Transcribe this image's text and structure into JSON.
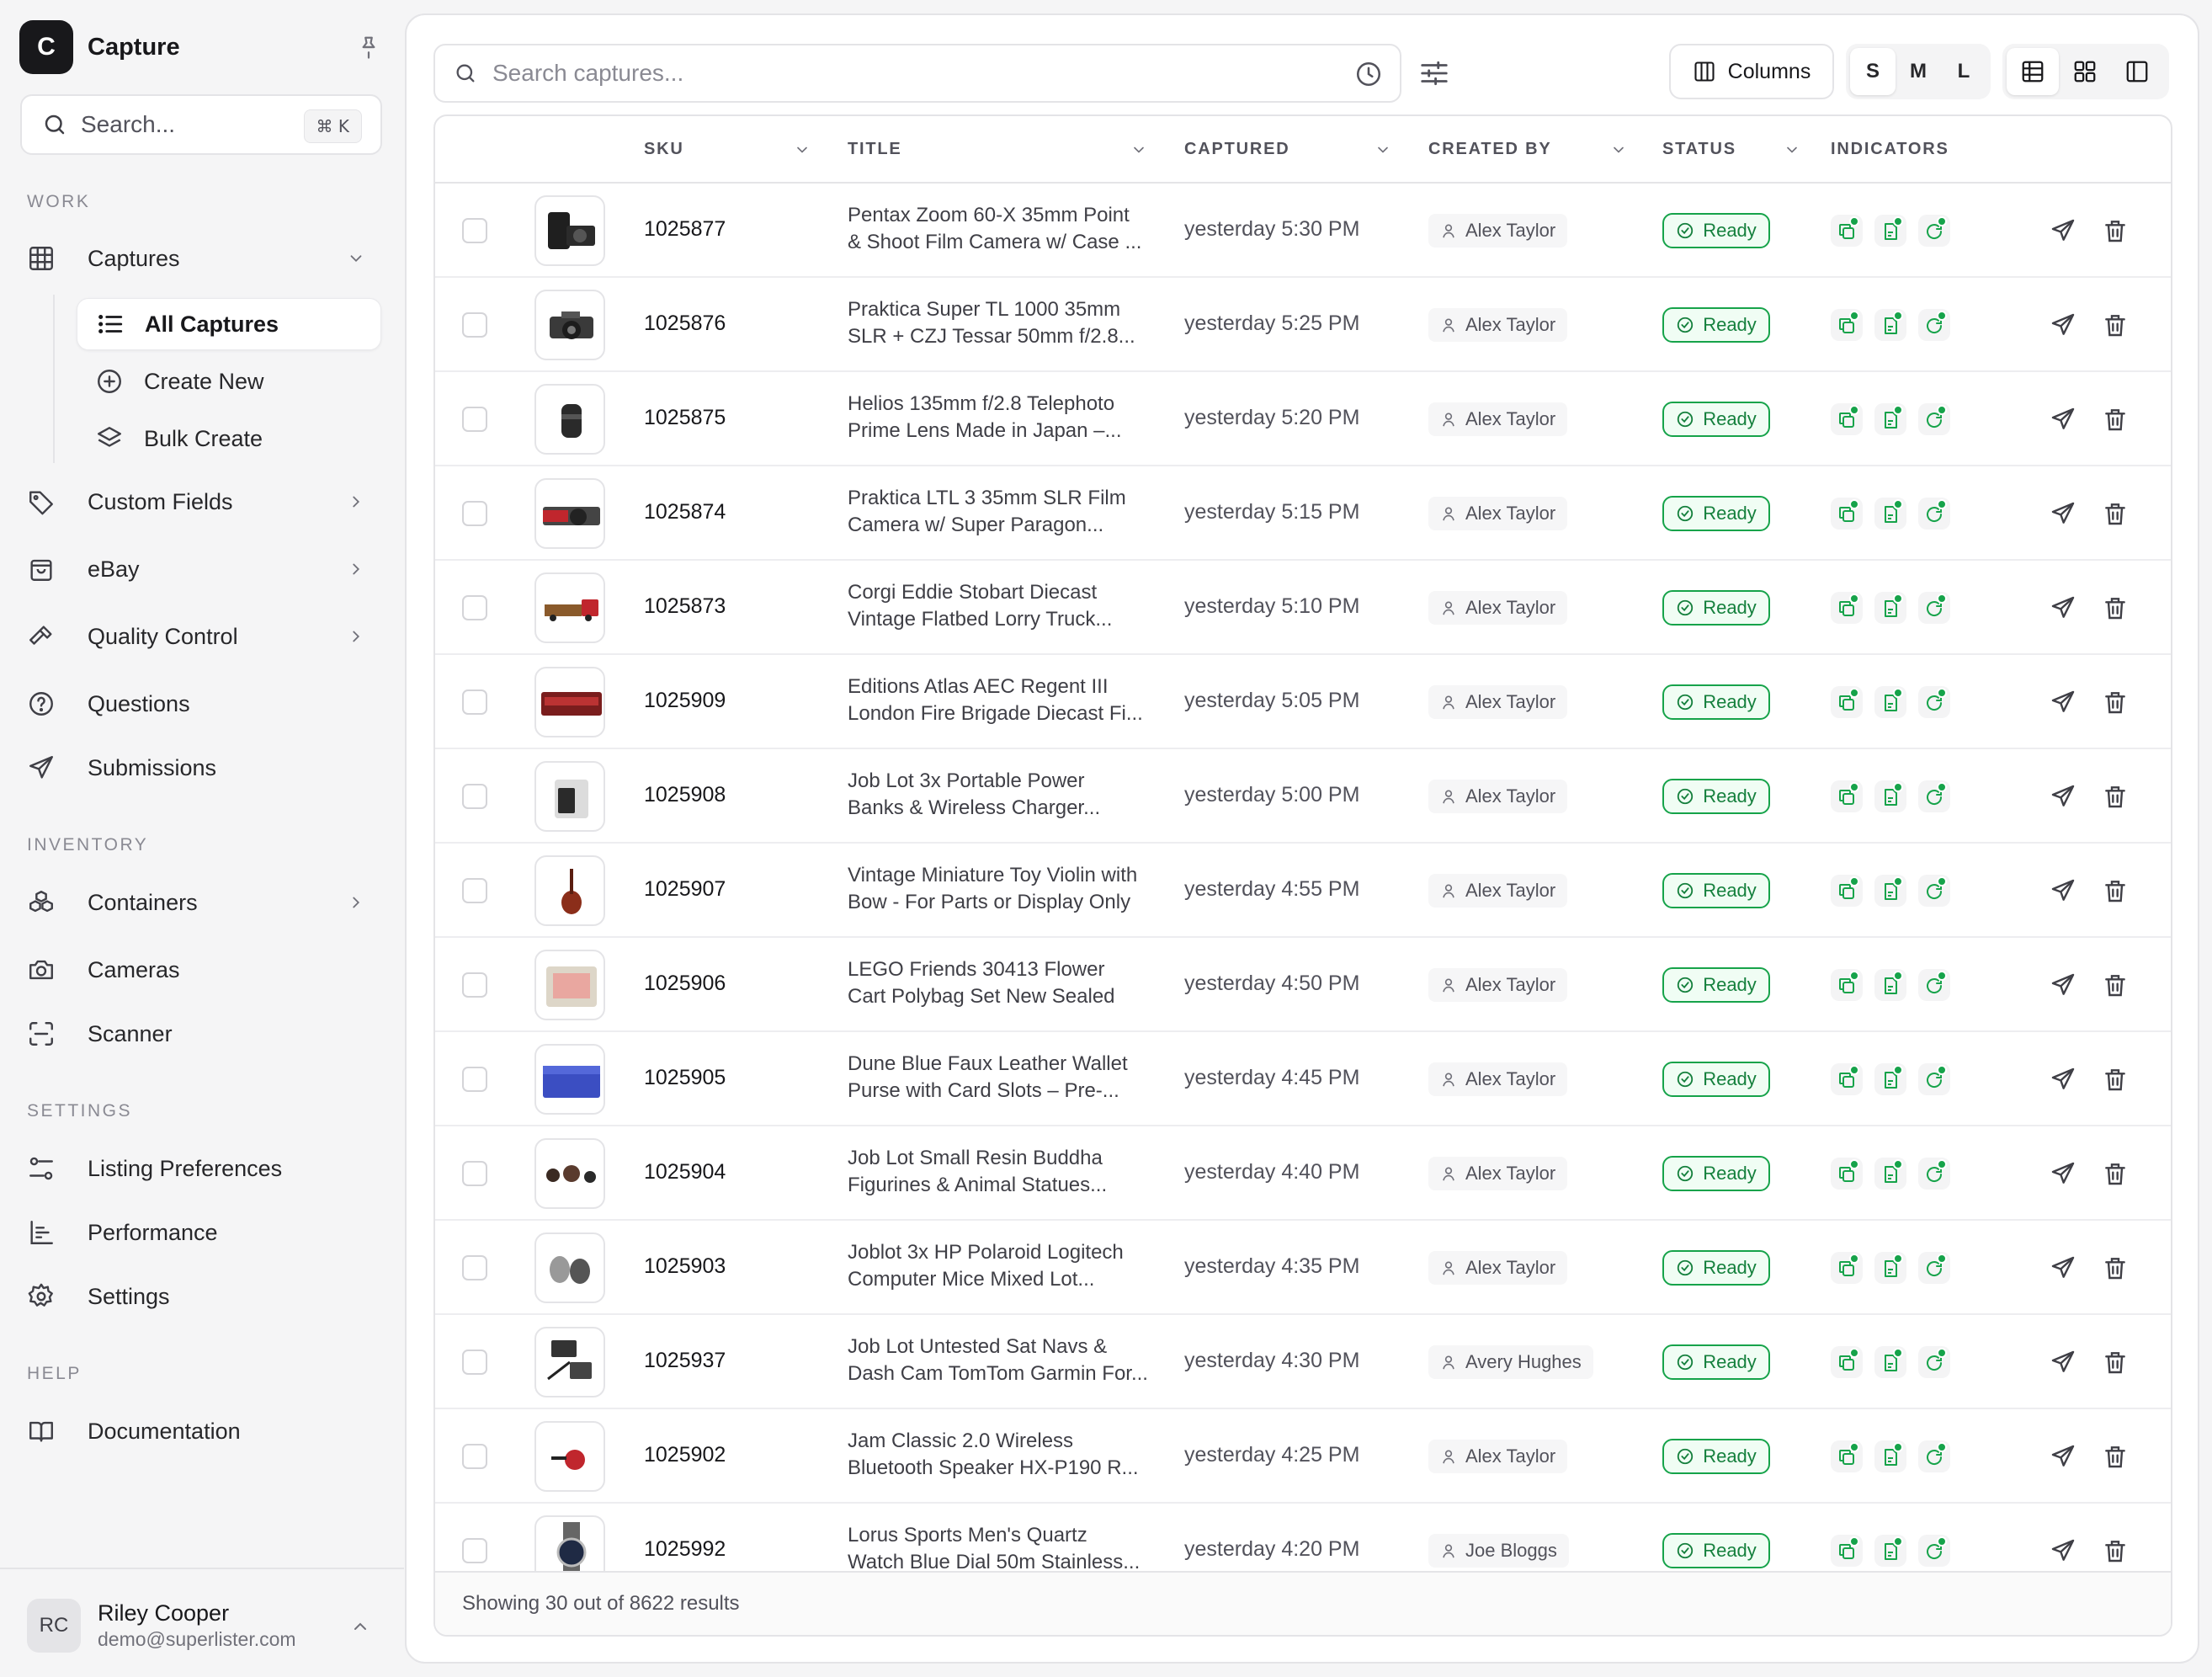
{
  "app": {
    "logo_letter": "C",
    "name": "Capture"
  },
  "sidebar": {
    "search_placeholder": "Search...",
    "search_shortcut": "⌘ K",
    "sections": {
      "work": "WORK",
      "inventory": "INVENTORY",
      "settings": "SETTINGS",
      "help": "HELP"
    },
    "items": {
      "captures": "Captures",
      "all_captures": "All Captures",
      "create_new": "Create New",
      "bulk_create": "Bulk Create",
      "custom_fields": "Custom Fields",
      "ebay": "eBay",
      "quality_control": "Quality Control",
      "questions": "Questions",
      "submissions": "Submissions",
      "containers": "Containers",
      "cameras": "Cameras",
      "scanner": "Scanner",
      "listing_preferences": "Listing Preferences",
      "performance": "Performance",
      "settings": "Settings",
      "documentation": "Documentation"
    },
    "user": {
      "initials": "RC",
      "name": "Riley Cooper",
      "email": "demo@superlister.com"
    }
  },
  "toolbar": {
    "search_placeholder": "Search captures...",
    "columns_label": "Columns",
    "sizes": [
      "S",
      "M",
      "L"
    ],
    "active_size": "S",
    "active_view": "table"
  },
  "table": {
    "headers": {
      "sku": "SKU",
      "title": "TITLE",
      "captured": "CAPTURED",
      "created_by": "CREATED BY",
      "status": "STATUS",
      "indicators": "INDICATORS"
    },
    "rows": [
      {
        "sku": "1025877",
        "title1": "Pentax Zoom 60-X 35mm Point",
        "title2": "& Shoot Film Camera w/ Case ...",
        "captured": "yesterday 5:30 PM",
        "created_by": "Alex Taylor",
        "status": "Ready",
        "thumb": "camera-case"
      },
      {
        "sku": "1025876",
        "title1": "Praktica Super TL 1000 35mm",
        "title2": "SLR + CZJ Tessar 50mm f/2.8...",
        "captured": "yesterday 5:25 PM",
        "created_by": "Alex Taylor",
        "status": "Ready",
        "thumb": "slr"
      },
      {
        "sku": "1025875",
        "title1": "Helios 135mm f/2.8 Telephoto",
        "title2": "Prime Lens Made in Japan –...",
        "captured": "yesterday 5:20 PM",
        "created_by": "Alex Taylor",
        "status": "Ready",
        "thumb": "lens"
      },
      {
        "sku": "1025874",
        "title1": "Praktica LTL 3 35mm SLR Film",
        "title2": "Camera w/ Super Paragon...",
        "captured": "yesterday 5:15 PM",
        "created_by": "Alex Taylor",
        "status": "Ready",
        "thumb": "slr-red"
      },
      {
        "sku": "1025873",
        "title1": "Corgi Eddie Stobart Diecast",
        "title2": "Vintage Flatbed Lorry Truck...",
        "captured": "yesterday 5:10 PM",
        "created_by": "Alex Taylor",
        "status": "Ready",
        "thumb": "truck"
      },
      {
        "sku": "1025909",
        "title1": "Editions Atlas AEC Regent III",
        "title2": "London Fire Brigade Diecast Fi...",
        "captured": "yesterday 5:05 PM",
        "created_by": "Alex Taylor",
        "status": "Ready",
        "thumb": "fire-truck"
      },
      {
        "sku": "1025908",
        "title1": "Job Lot 3x Portable Power",
        "title2": "Banks & Wireless Charger...",
        "captured": "yesterday 5:00 PM",
        "created_by": "Alex Taylor",
        "status": "Ready",
        "thumb": "powerbank"
      },
      {
        "sku": "1025907",
        "title1": "Vintage Miniature Toy Violin with",
        "title2": "Bow - For Parts or Display Only",
        "captured": "yesterday 4:55 PM",
        "created_by": "Alex Taylor",
        "status": "Ready",
        "thumb": "violin"
      },
      {
        "sku": "1025906",
        "title1": "LEGO Friends 30413 Flower",
        "title2": "Cart Polybag Set New Sealed",
        "captured": "yesterday 4:50 PM",
        "created_by": "Alex Taylor",
        "status": "Ready",
        "thumb": "polybag"
      },
      {
        "sku": "1025905",
        "title1": "Dune Blue Faux Leather Wallet",
        "title2": "Purse with Card Slots – Pre-...",
        "captured": "yesterday 4:45 PM",
        "created_by": "Alex Taylor",
        "status": "Ready",
        "thumb": "wallet"
      },
      {
        "sku": "1025904",
        "title1": "Job Lot Small Resin Buddha",
        "title2": "Figurines & Animal Statues...",
        "captured": "yesterday 4:40 PM",
        "created_by": "Alex Taylor",
        "status": "Ready",
        "thumb": "figurines"
      },
      {
        "sku": "1025903",
        "title1": "Joblot 3x HP Polaroid Logitech",
        "title2": "Computer Mice Mixed Lot...",
        "captured": "yesterday 4:35 PM",
        "created_by": "Alex Taylor",
        "status": "Ready",
        "thumb": "mice"
      },
      {
        "sku": "1025937",
        "title1": "Job Lot Untested Sat Navs &",
        "title2": "Dash Cam TomTom Garmin For...",
        "captured": "yesterday 4:30 PM",
        "created_by": "Avery Hughes",
        "status": "Ready",
        "thumb": "satnav"
      },
      {
        "sku": "1025902",
        "title1": "Jam Classic 2.0 Wireless",
        "title2": "Bluetooth Speaker HX-P190 R...",
        "captured": "yesterday 4:25 PM",
        "created_by": "Alex Taylor",
        "status": "Ready",
        "thumb": "speaker"
      },
      {
        "sku": "1025992",
        "title1": "Lorus Sports Men's Quartz",
        "title2": "Watch Blue Dial 50m Stainless...",
        "captured": "yesterday 4:20 PM",
        "created_by": "Joe Bloggs",
        "status": "Ready",
        "thumb": "watch"
      }
    ],
    "footer": "Showing 30 out of 8622 results"
  },
  "colors": {
    "accent": "#16a34a",
    "status_bg": "#f0fdf4",
    "brand": "#18181b"
  }
}
